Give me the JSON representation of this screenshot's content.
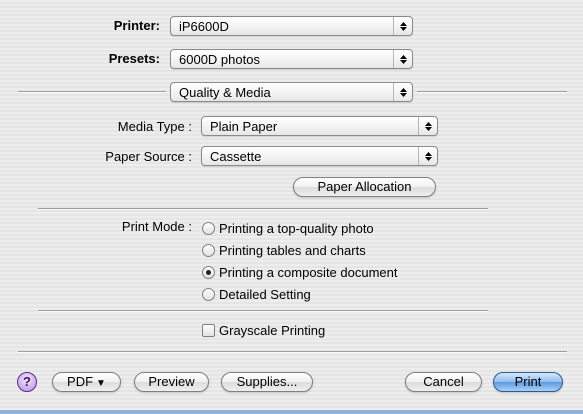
{
  "printer": {
    "label": "Printer:",
    "value": "iP6600D"
  },
  "presets": {
    "label": "Presets:",
    "value": "6000D photos"
  },
  "panel_menu": {
    "value": "Quality & Media"
  },
  "media_type": {
    "label": "Media Type :",
    "value": "Plain Paper"
  },
  "paper_source": {
    "label": "Paper Source :",
    "value": "Cassette"
  },
  "paper_allocation_label": "Paper Allocation",
  "print_mode": {
    "label": "Print Mode :",
    "options": [
      {
        "label": "Printing a top-quality photo",
        "selected": false
      },
      {
        "label": "Printing tables and charts",
        "selected": false
      },
      {
        "label": "Printing a composite document",
        "selected": true
      },
      {
        "label": "Detailed Setting",
        "selected": false
      }
    ]
  },
  "grayscale": {
    "label": "Grayscale Printing",
    "checked": false
  },
  "footer": {
    "help_label": "?",
    "pdf_label": "PDF",
    "preview_label": "Preview",
    "supplies_label": "Supplies...",
    "cancel_label": "Cancel",
    "print_label": "Print"
  }
}
